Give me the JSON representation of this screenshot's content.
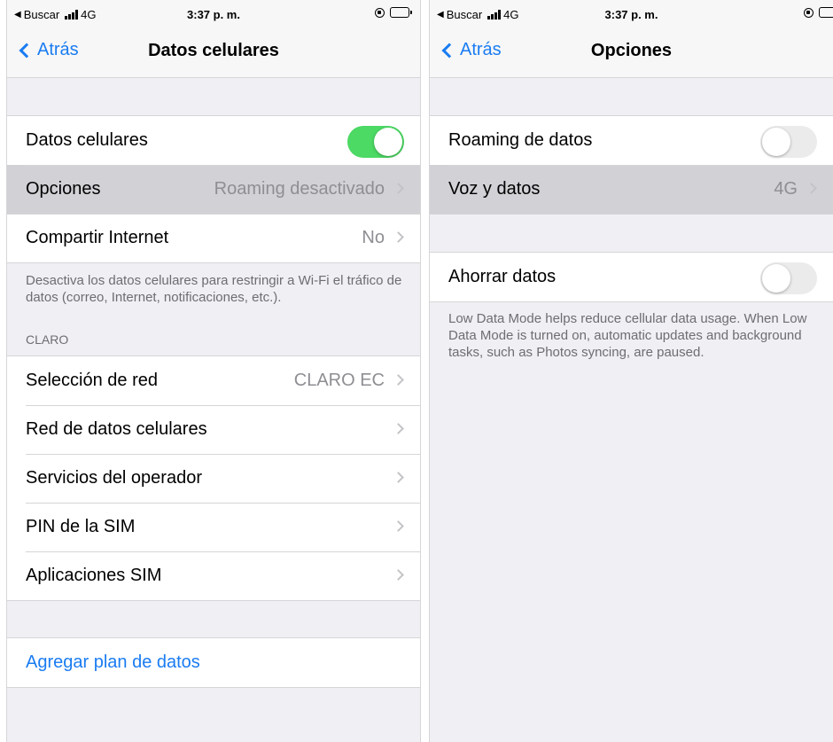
{
  "colors": {
    "accent": "#1a7cf2",
    "toggle_on": "#4cd964",
    "background": "#efeff4",
    "selected_row": "#d1d1d6"
  },
  "left": {
    "status": {
      "back_app": "Buscar",
      "network": "4G",
      "time": "3:37 p. m."
    },
    "nav": {
      "back_label": "Atrás",
      "title": "Datos celulares"
    },
    "rows": {
      "datos_celulares": {
        "label": "Datos celulares",
        "toggle": "on"
      },
      "opciones": {
        "label": "Opciones",
        "value": "Roaming desactivado"
      },
      "compartir": {
        "label": "Compartir Internet",
        "value": "No"
      }
    },
    "footer": "Desactiva los datos celulares para restringir a Wi-Fi el tráfico de datos (correo, Internet, notificaciones, etc.).",
    "section_header": "CLARO",
    "carrier_rows": [
      {
        "label": "Selección de red",
        "value": "CLARO EC"
      },
      {
        "label": "Red de datos celulares",
        "value": ""
      },
      {
        "label": "Servicios del operador",
        "value": ""
      },
      {
        "label": "PIN de la SIM",
        "value": ""
      },
      {
        "label": "Aplicaciones SIM",
        "value": ""
      }
    ],
    "add_plan": "Agregar plan de datos"
  },
  "right": {
    "status": {
      "back_app": "Buscar",
      "network": "4G",
      "time": "3:37 p. m."
    },
    "nav": {
      "back_label": "Atrás",
      "title": "Opciones"
    },
    "rows": {
      "roaming": {
        "label": "Roaming de datos",
        "toggle": "off"
      },
      "voz": {
        "label": "Voz y datos",
        "value": "4G"
      },
      "ahorrar": {
        "label": "Ahorrar datos",
        "toggle": "off"
      }
    },
    "footer": "Low Data Mode helps reduce cellular data usage. When Low Data Mode is turned on, automatic updates and background tasks, such as Photos syncing, are paused."
  }
}
